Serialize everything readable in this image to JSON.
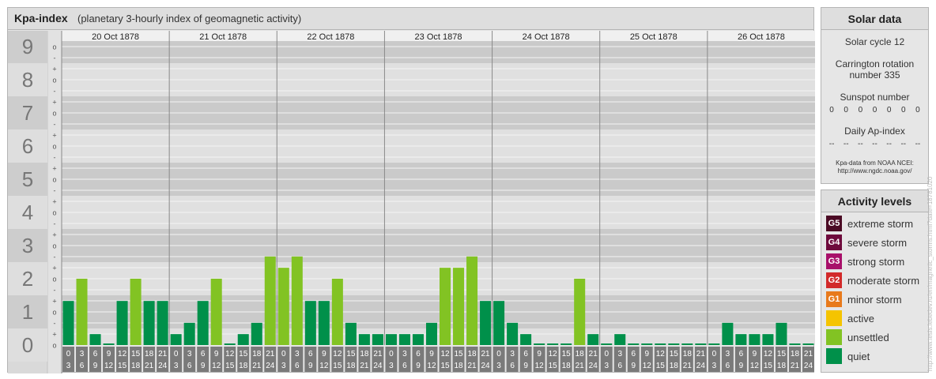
{
  "header": {
    "title": "Kpa-index",
    "subtitle": "(planetary 3-hourly index of geomagnetic activity)"
  },
  "chart_data": {
    "type": "bar",
    "title": "Kpa-index",
    "subtitle": "(planetary 3-hourly index of geomagnetic activity)",
    "days": [
      "20 Oct 1878",
      "21 Oct 1878",
      "22 Oct 1878",
      "23 Oct 1878",
      "24 Oct 1878",
      "25 Oct 1878",
      "26 Oct 1878"
    ],
    "intervals": [
      {
        "start": "0",
        "end": "3"
      },
      {
        "start": "3",
        "end": "6"
      },
      {
        "start": "6",
        "end": "9"
      },
      {
        "start": "9",
        "end": "12"
      },
      {
        "start": "12",
        "end": "15"
      },
      {
        "start": "15",
        "end": "18"
      },
      {
        "start": "18",
        "end": "21"
      },
      {
        "start": "21",
        "end": "24"
      }
    ],
    "y_ticks": [
      "0",
      "1",
      "2",
      "3",
      "4",
      "5",
      "6",
      "7",
      "8",
      "9"
    ],
    "sub_ticks": [
      "-",
      "o",
      "+"
    ],
    "ylim": [
      0,
      9.33
    ],
    "values": [
      1.33,
      2.0,
      0.33,
      0.0,
      1.33,
      2.0,
      1.33,
      1.33,
      0.33,
      0.67,
      1.33,
      2.0,
      0.0,
      0.33,
      0.67,
      2.67,
      2.33,
      2.67,
      1.33,
      1.33,
      2.0,
      0.67,
      0.33,
      0.33,
      0.33,
      0.33,
      0.33,
      0.67,
      2.33,
      2.33,
      2.67,
      1.33,
      1.33,
      0.67,
      0.33,
      0.0,
      0.0,
      0.0,
      2.0,
      0.33,
      0.0,
      0.33,
      0.0,
      0.0,
      0.0,
      0.0,
      0.0,
      0.0,
      0.0,
      0.67,
      0.33,
      0.33,
      0.33,
      0.67,
      0.0,
      0.0
    ],
    "grid": true
  },
  "solar": {
    "title": "Solar data",
    "cycle": "Solar cycle 12",
    "carrington_line1": "Carrington rotation",
    "carrington_line2": "number 335",
    "sunspot_label": "Sunspot number",
    "sunspot_values": [
      "0",
      "0",
      "0",
      "0",
      "0",
      "0",
      "0"
    ],
    "ap_label": "Daily Ap-index",
    "ap_values": [
      "--",
      "--",
      "--",
      "--",
      "--",
      "--",
      "--"
    ],
    "credit_line1": "Kpa-data from NOAA NCEI:",
    "credit_line2": "http://www.ngdc.noaa.gov/"
  },
  "activity": {
    "title": "Activity levels",
    "levels": [
      {
        "badge": "G5",
        "label": "extreme storm",
        "color": "#4b0a24"
      },
      {
        "badge": "G4",
        "label": "severe storm",
        "color": "#6e0a3c"
      },
      {
        "badge": "G3",
        "label": "strong storm",
        "color": "#a8106a"
      },
      {
        "badge": "G2",
        "label": "moderate storm",
        "color": "#d22a2a"
      },
      {
        "badge": "G1",
        "label": "minor storm",
        "color": "#e87a1c"
      },
      {
        "badge": "",
        "label": "active",
        "color": "#f5c400"
      },
      {
        "badge": "",
        "label": "unsettled",
        "color": "#82c323"
      },
      {
        "badge": "",
        "label": "quiet",
        "color": "#00904a"
      }
    ]
  },
  "colors": {
    "quiet": "#00904a",
    "unsettled": "#82c323",
    "band_dark": "#cacaca",
    "band_light": "#e0e0e0"
  },
  "watermark": "http://www.tesis.lebedev.ru/en/magnetic_storms.html?date=18781020"
}
